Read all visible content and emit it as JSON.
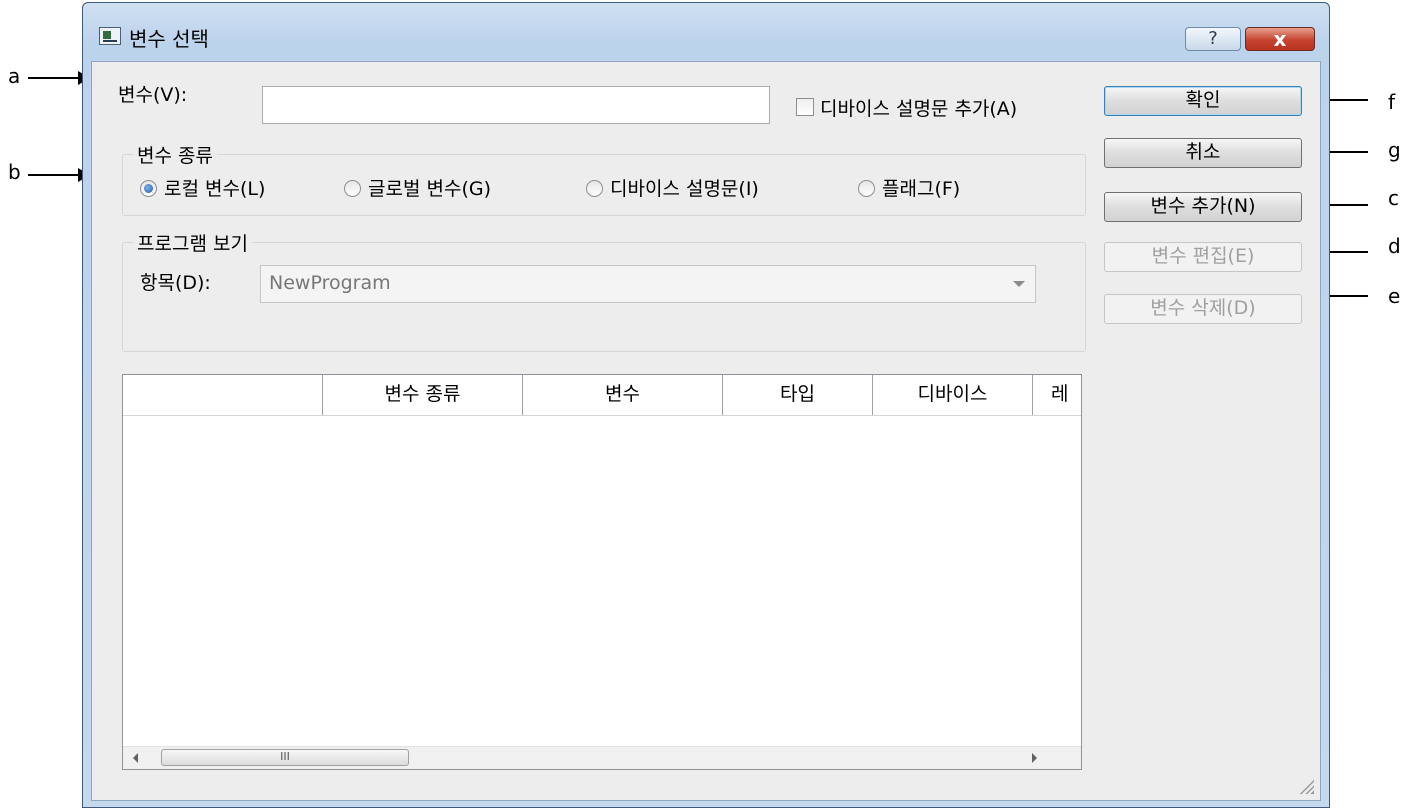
{
  "callouts": {
    "a": "a",
    "b": "b",
    "c": "c",
    "d": "d",
    "e": "e",
    "f": "f",
    "g": "g"
  },
  "window": {
    "title": "변수 선택",
    "help_glyph": "?",
    "close_glyph": "x"
  },
  "variable": {
    "label": "변수(V):",
    "value": ""
  },
  "device_comment_checkbox": {
    "label": "디바이스 설명문 추가(A)",
    "checked": false
  },
  "variable_kind": {
    "title": "변수 종류",
    "options": [
      {
        "label": "로컬 변수(L)",
        "checked": true
      },
      {
        "label": "글로벌 변수(G)",
        "checked": false
      },
      {
        "label": "디바이스 설명문(I)",
        "checked": false
      },
      {
        "label": "플래그(F)",
        "checked": false
      }
    ]
  },
  "program_view": {
    "title": "프로그램 보기",
    "item_label": "항목(D):",
    "item_value": "NewProgram"
  },
  "buttons": {
    "ok": "확인",
    "cancel": "취소",
    "add": "변수 추가(N)",
    "edit": "변수 편집(E)",
    "delete": "변수 삭제(D)"
  },
  "table": {
    "columns": [
      "",
      "변수 종류",
      "변수",
      "타입",
      "디바이스",
      "레"
    ],
    "rows": []
  },
  "scrollbar": {
    "thumb_glyph": "III"
  },
  "icons": {
    "window": "app-icon",
    "help": "help-icon",
    "close": "close-icon",
    "dropdown": "chevron-down-icon",
    "grip": "resize-grip-icon"
  }
}
